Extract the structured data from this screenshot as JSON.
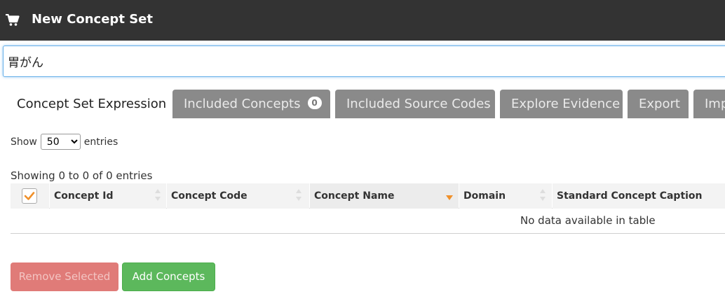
{
  "header": {
    "title": "New Concept Set",
    "icon": "cart-icon"
  },
  "name_input": {
    "value": "胃がん"
  },
  "tabs": [
    {
      "label": "Concept Set Expression",
      "active": true
    },
    {
      "label": "Included Concepts",
      "badge": "0"
    },
    {
      "label": "Included Source Codes"
    },
    {
      "label": "Explore Evidence"
    },
    {
      "label": "Export"
    },
    {
      "label": "Imp"
    }
  ],
  "length_menu": {
    "show_label": "Show",
    "selected": "50",
    "entries_label": "entries"
  },
  "info_text": "Showing 0 to 0 of 0 entries",
  "table": {
    "columns": [
      "Concept Id",
      "Concept Code",
      "Concept Name",
      "Domain",
      "Standard Concept Caption"
    ],
    "empty_message": "No data available in table"
  },
  "buttons": {
    "remove": "Remove Selected",
    "add": "Add Concepts"
  },
  "colors": {
    "header_bg": "#333333",
    "tab_inactive": "#8a8a8a",
    "sort_active": "#f0902a",
    "remove_bg": "#e07b78",
    "add_bg": "#5cb85c"
  }
}
